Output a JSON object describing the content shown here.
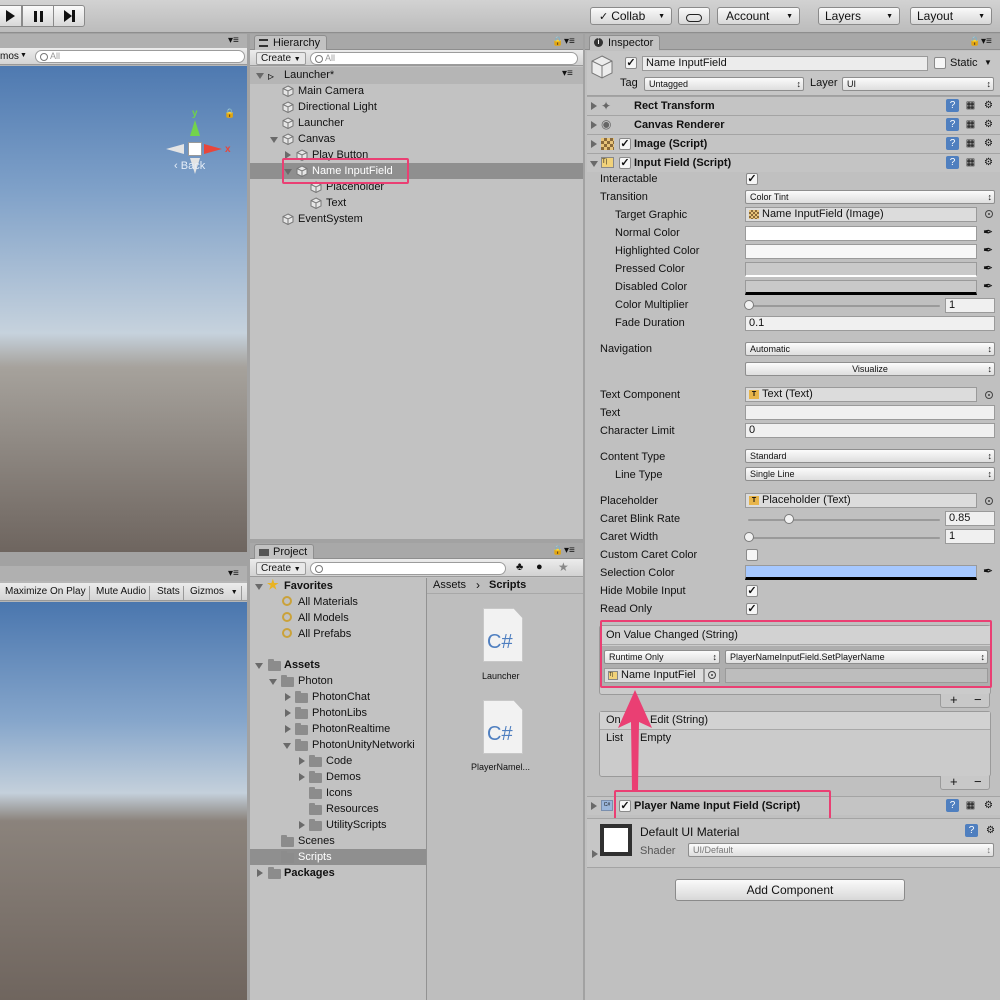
{
  "toolbar": {
    "collab": "Collab",
    "account": "Account",
    "layers": "Layers",
    "layout": "Layout"
  },
  "scene": {
    "tab_text": "mos",
    "search_placeholder": "All",
    "gizmo_x": "x",
    "gizmo_y": "y",
    "back_label": "Back"
  },
  "game": {
    "toolbar": [
      "Maximize On Play",
      "Mute Audio",
      "Stats",
      "Gizmos"
    ]
  },
  "hierarchy": {
    "tab": "Hierarchy",
    "create": "Create",
    "search_placeholder": "All",
    "scene": "Launcher*",
    "items": [
      "Main Camera",
      "Directional Light",
      "Launcher",
      "Canvas",
      "Play Button",
      "Name InputField",
      "Placeholder",
      "Text",
      "EventSystem"
    ]
  },
  "project": {
    "tab": "Project",
    "create": "Create",
    "favorites": "Favorites",
    "fav_items": [
      "All Materials",
      "All Models",
      "All Prefabs"
    ],
    "assets": "Assets",
    "folders": [
      "Photon",
      "PhotonChat",
      "PhotonLibs",
      "PhotonRealtime",
      "PhotonUnityNetworki",
      "Code",
      "Demos",
      "Icons",
      "Resources",
      "UtilityScripts",
      "Scenes",
      "Scripts"
    ],
    "packages": "Packages",
    "breadcrumb_assets": "Assets",
    "breadcrumb_scripts": "Scripts",
    "files": [
      {
        "name": "Launcher",
        "glyph": "C#"
      },
      {
        "name": "PlayerNamel...",
        "glyph": "C#"
      }
    ]
  },
  "inspector": {
    "tab": "Inspector",
    "object_name": "Name InputField",
    "static_label": "Static",
    "tag_label": "Tag",
    "tag_value": "Untagged",
    "layer_label": "Layer",
    "layer_value": "UI",
    "components": {
      "rect_transform": "Rect Transform",
      "canvas_renderer": "Canvas Renderer",
      "image": "Image (Script)",
      "input_field": "Input Field (Script)",
      "player_name": "Player Name Input Field (Script)"
    },
    "props": {
      "interactable": "Interactable",
      "transition": "Transition",
      "transition_value": "Color Tint",
      "target_graphic": "Target Graphic",
      "target_graphic_value": "Name InputField (Image)",
      "normal_color": "Normal Color",
      "highlighted_color": "Highlighted Color",
      "pressed_color": "Pressed Color",
      "disabled_color": "Disabled Color",
      "color_multiplier": "Color Multiplier",
      "color_multiplier_value": "1",
      "fade_duration": "Fade Duration",
      "fade_duration_value": "0.1",
      "navigation": "Navigation",
      "navigation_value": "Automatic",
      "visualize": "Visualize",
      "text_component": "Text Component",
      "text_component_value": "Text (Text)",
      "text": "Text",
      "text_value": "",
      "character_limit": "Character Limit",
      "character_limit_value": "0",
      "content_type": "Content Type",
      "content_type_value": "Standard",
      "line_type": "Line Type",
      "line_type_value": "Single Line",
      "placeholder": "Placeholder",
      "placeholder_value": "Placeholder (Text)",
      "caret_blink_rate": "Caret Blink Rate",
      "caret_blink_rate_value": "0.85",
      "caret_width": "Caret Width",
      "caret_width_value": "1",
      "custom_caret_color": "Custom Caret Color",
      "selection_color": "Selection Color",
      "hide_mobile_input": "Hide Mobile Input",
      "read_only": "Read Only"
    },
    "events": {
      "on_value_changed": "On Value Changed (String)",
      "runtime": "Runtime Only",
      "function": "PlayerNameInputField.SetPlayerName",
      "target": "Name InputFiel",
      "on_end_edit_left": "On",
      "on_end_edit_right": "Edit (String)",
      "list_left": "List",
      "list_right": "Empty"
    },
    "material": {
      "name": "Default UI Material",
      "shader_label": "Shader",
      "shader_value": "UI/Default"
    },
    "add_component": "Add Component"
  },
  "colors": {
    "highlight": "#ea3f73",
    "selection_color": "#a6c8ff",
    "selected_row": "#8f8f8f"
  }
}
